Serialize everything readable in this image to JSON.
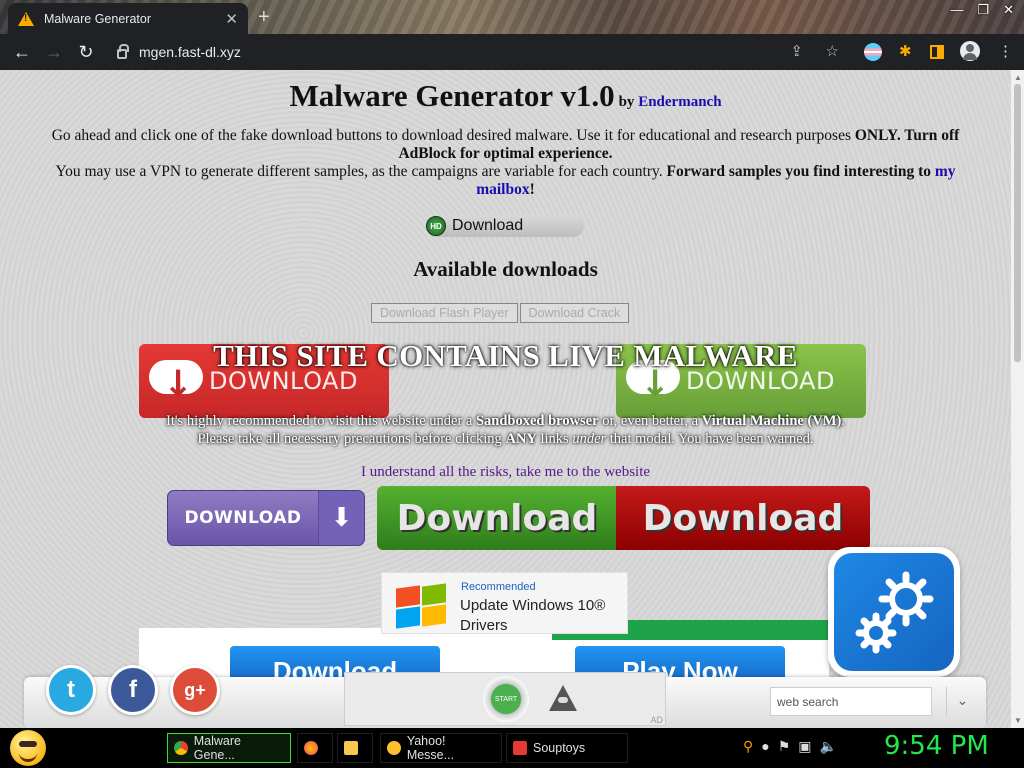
{
  "browser": {
    "tab_title": "Malware Generator",
    "tab_close": "✕",
    "new_tab": "+",
    "window_buttons": [
      "—",
      "❐",
      "✕"
    ],
    "nav": {
      "back": "←",
      "forward": "→",
      "reload": "↻"
    },
    "url": "mgen.fast-dl.xyz",
    "icons": {
      "share": "⇪",
      "star": "☆",
      "puzzle": "✱",
      "menu": "⋮"
    }
  },
  "page": {
    "title": "Malware Generator v1.0",
    "by_label": "by",
    "author": "Endermanch",
    "intro_line1_plain": "Go ahead and click one of the fake download buttons to download desired malware. Use it for educational and research purposes ",
    "intro_only": "ONLY",
    "intro_turnoff": ". Turn off AdBlock for optimal experience.",
    "intro_line2_plain": "You may use a VPN to generate different samples, as the campaigns are variable for each country. ",
    "intro_forward": "Forward samples you find interesting to",
    "intro_link": "my mailbox",
    "intro_end": "!",
    "hd_badge": "HD",
    "hd_download": "Download",
    "available_heading": "Available downloads",
    "flash_button": "Download Flash Player",
    "crack_button": "Download Crack",
    "warning_title": "THIS SITE CONTAINS LIVE MALWARE",
    "warning_p1_a": "It's highly recommended to visit this website under a ",
    "warning_p1_b": "Sandboxed browser",
    "warning_p1_c": " or, even better, a ",
    "warning_p1_d": "Virtual Machine (VM)",
    "warning_p1_e": ".",
    "warning_p2_a": "Please take all necessary precautions before clicking ",
    "warning_p2_b": "ANY",
    "warning_p2_c": " links ",
    "warning_p2_d": "under",
    "warning_p2_e": " that modal. You have been warned.",
    "understand_link": "I understand all the risks, take me to the website",
    "red_download": "DOWNLOAD",
    "green_download": "DOWNLOAD",
    "purple_download": "DOWNLOAD",
    "purple_arrow": "⬇",
    "green_big": "Download",
    "red_big": "Download",
    "win_ad": {
      "recommended": "Recommended",
      "line1": "Update Windows 10®",
      "line2": "Drivers"
    },
    "blue_btn1": "Download",
    "blue_btn2": "Play Now"
  },
  "bottom_bar": {
    "twitter": "t",
    "facebook": "f",
    "googleplus": "g+",
    "start": "START",
    "ad": "AD",
    "search_placeholder": "web search",
    "chevron": "⌄"
  },
  "taskbar": {
    "items": [
      {
        "label": "Malware Gene...",
        "active": true,
        "icon_color": "#4285f4"
      },
      {
        "label": "",
        "active": false,
        "icon_color": "#ff7139"
      },
      {
        "label": "",
        "active": false,
        "icon_color": "#f9c74f"
      },
      {
        "label": "Yahoo! Messe...",
        "active": false,
        "icon_color": "#fbc02d"
      },
      {
        "label": "Souptoys",
        "active": false,
        "icon_color": "#e53935"
      }
    ],
    "tray": [
      "⚲",
      "●",
      "⚑",
      "▣",
      "🔈"
    ],
    "clock": "9:54 PM"
  }
}
